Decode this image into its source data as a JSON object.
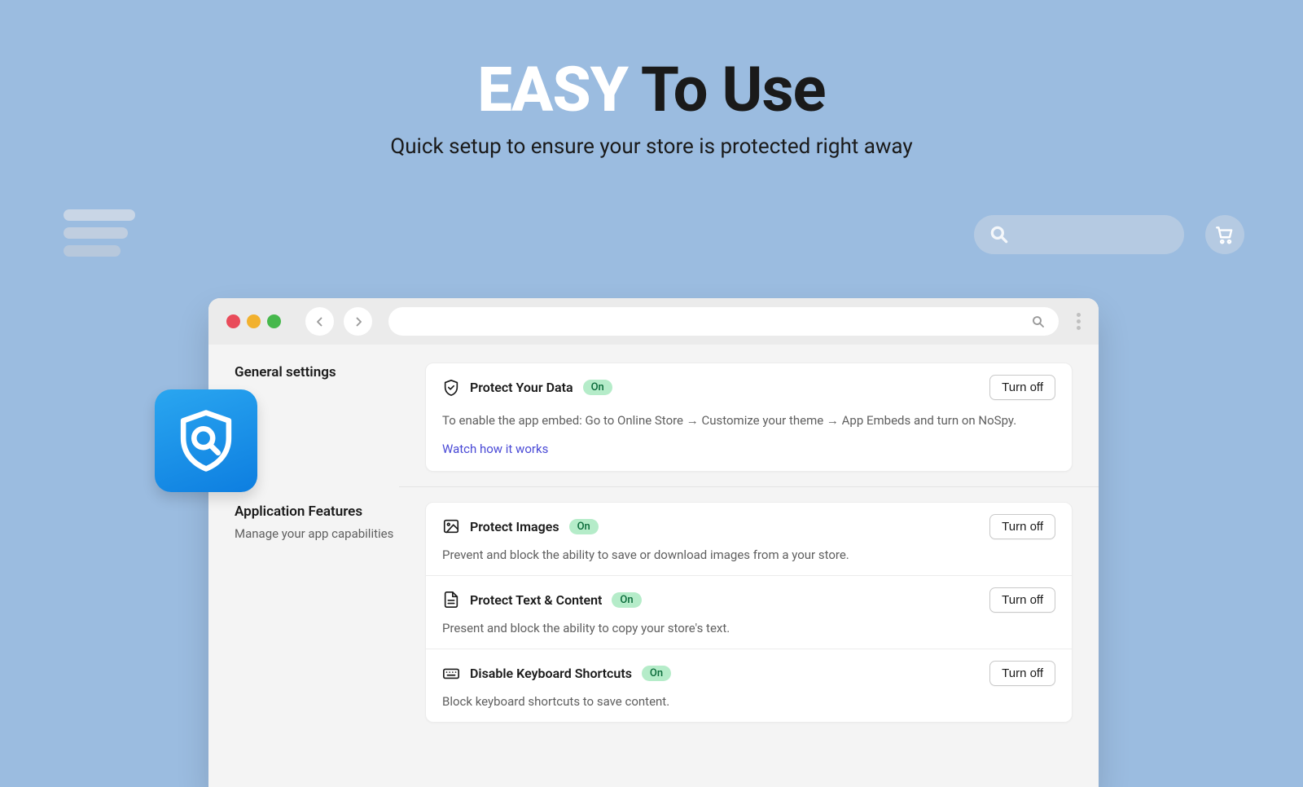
{
  "hero": {
    "title_bold": "EASY",
    "title_rest": " To Use",
    "subtitle": "Quick setup to ensure your store is protected right away"
  },
  "sections": {
    "general": {
      "title": "General settings"
    },
    "features": {
      "title": "Application Features",
      "subtitle": "Manage your app capabilities"
    }
  },
  "badges": {
    "on": "On"
  },
  "buttons": {
    "turn_off": "Turn off"
  },
  "protect_data": {
    "title": "Protect Your Data",
    "desc": "To enable the app embed: Go to Online Store → Customize your theme → App Embeds and turn on NoSpy.",
    "link": "Watch how it works"
  },
  "protect_images": {
    "title": "Protect Images",
    "desc": "Prevent and block the ability to save or download images from a your store."
  },
  "protect_text": {
    "title": "Protect Text & Content",
    "desc": "Present and block the ability to copy your store's text."
  },
  "disable_keyboard": {
    "title": "Disable Keyboard Shortcuts",
    "desc": "Block keyboard shortcuts to save content."
  }
}
